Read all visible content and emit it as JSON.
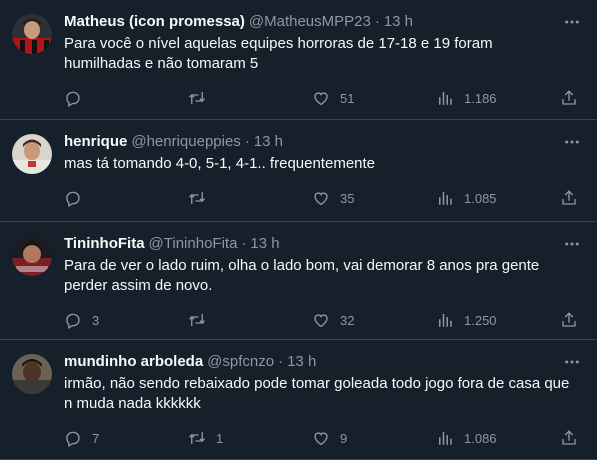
{
  "tweets": [
    {
      "name": "Matheus (icon promessa)",
      "handle": "@MatheusMPP23",
      "dot": "·",
      "time": "13 h",
      "text": "Para você o nível aquelas equipes horroras de 17-18 e 19 foram humilhadas e não tomaram 5",
      "replies": "",
      "retweets": "",
      "likes": "51",
      "views": "1.186"
    },
    {
      "name": "henrique",
      "handle": "@henriqueppies",
      "dot": "·",
      "time": "13 h",
      "text": "mas tá tomando 4-0, 5-1, 4-1.. frequentemente",
      "replies": "",
      "retweets": "",
      "likes": "35",
      "views": "1.085"
    },
    {
      "name": "TininhoFita",
      "handle": "@TininhoFita",
      "dot": "·",
      "time": "13 h",
      "text": "Para de ver o lado ruim, olha o lado bom, vai demorar 8 anos pra gente perder assim de novo.",
      "replies": "3",
      "retweets": "",
      "likes": "32",
      "views": "1.250"
    },
    {
      "name": "mundinho arboleda",
      "handle": "@spfcnzo",
      "dot": "·",
      "time": "13 h",
      "text": "irmão, não sendo rebaixado pode tomar goleada todo jogo fora de casa que n muda nada kkkkkk",
      "replies": "7",
      "retweets": "1",
      "likes": "9",
      "views": "1.086"
    }
  ],
  "icons": {
    "reply": "reply-icon",
    "retweet": "retweet-icon",
    "like": "heart-icon",
    "views": "views-icon",
    "share": "share-icon",
    "more": "more-icon"
  },
  "colors": {
    "background": "#15202b",
    "text": "#f7f9f9",
    "secondary": "#8b98a5",
    "divider": "#38444d"
  }
}
